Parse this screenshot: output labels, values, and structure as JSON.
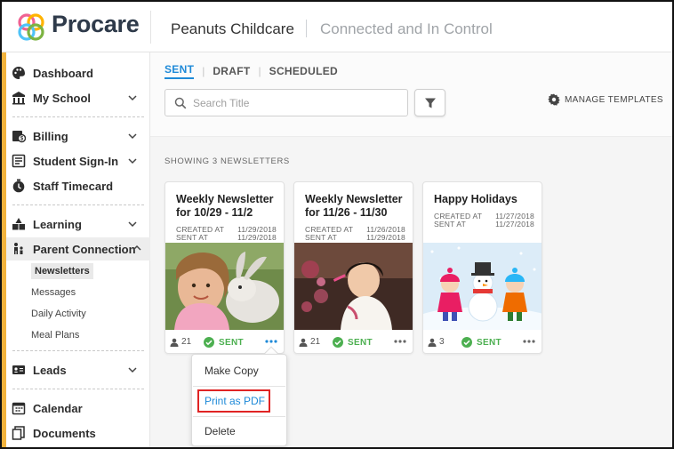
{
  "brand": {
    "name": "Procare"
  },
  "header": {
    "school_name": "Peanuts Childcare",
    "tagline": "Connected and In Control"
  },
  "sidebar": {
    "items": [
      {
        "label": "Dashboard",
        "icon": "palette-icon"
      },
      {
        "label": "My School",
        "icon": "school-icon"
      },
      {
        "label": "Billing",
        "icon": "billing-icon"
      },
      {
        "label": "Student Sign-In",
        "icon": "checklist-icon"
      },
      {
        "label": "Staff Timecard",
        "icon": "timecard-icon"
      },
      {
        "label": "Learning",
        "icon": "blocks-icon"
      },
      {
        "label": "Parent Connection",
        "icon": "family-icon"
      },
      {
        "label": "Leads",
        "icon": "id-card-icon"
      },
      {
        "label": "Calendar",
        "icon": "calendar-icon"
      },
      {
        "label": "Documents",
        "icon": "documents-icon"
      }
    ],
    "sub_items": [
      "Newsletters",
      "Messages",
      "Daily Activity",
      "Meal Plans"
    ],
    "accent_color": "#f2b33d"
  },
  "tabs": [
    "SENT",
    "DRAFT",
    "SCHEDULED"
  ],
  "search": {
    "placeholder": "Search Title",
    "value": ""
  },
  "manage_templates": "MANAGE TEMPLATES",
  "showing_count": "SHOWING 3 NEWSLETTERS",
  "card_labels": {
    "created": "CREATED AT",
    "sent": "SENT AT"
  },
  "cards": [
    {
      "title": "Weekly Newsletter for 10/29 - 11/2",
      "created": "11/29/2018",
      "sent": "11/29/2018",
      "recipients": "21",
      "status": "SENT"
    },
    {
      "title": "Weekly Newsletter for 11/26 - 11/30",
      "created": "11/26/2018",
      "sent": "11/29/2018",
      "recipients": "21",
      "status": "SENT"
    },
    {
      "title": "Happy Holidays",
      "created": "11/27/2018",
      "sent": "11/27/2018",
      "recipients": "3",
      "status": "SENT"
    }
  ],
  "menu": {
    "items": [
      "Make Copy",
      "Print as PDF",
      "Delete"
    ]
  },
  "colors": {
    "accent": "#1f8ad8",
    "status_sent": "#4caf50",
    "highlight": "#e02424"
  }
}
